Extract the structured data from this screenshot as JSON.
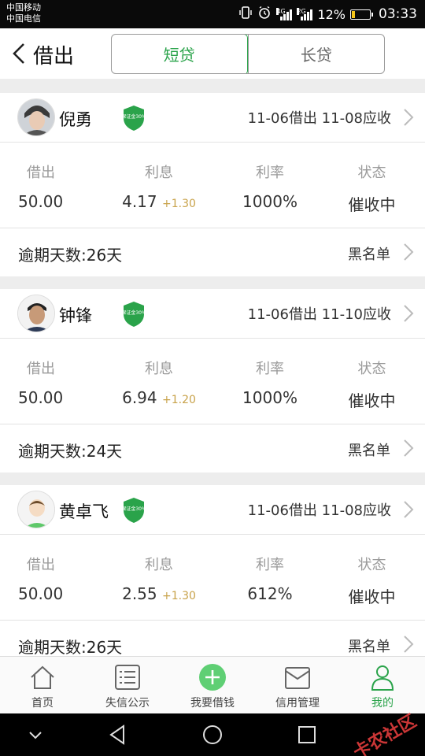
{
  "status_bar": {
    "carrier1": "中国移动",
    "carrier2": "中国电信",
    "battery": "12%",
    "time": "03:33",
    "icons": [
      "vibrate-icon",
      "alarm-icon",
      "signal-4g-icon",
      "signal-2g-icon",
      "battery-icon"
    ]
  },
  "header": {
    "title": "借出",
    "tabs": [
      {
        "label": "短贷",
        "active": true
      },
      {
        "label": "长贷",
        "active": false
      }
    ]
  },
  "stat_labels": {
    "lent": "借出",
    "interest": "利息",
    "rate": "利率",
    "status": "状态"
  },
  "records": [
    {
      "name": "倪勇",
      "badge": "保证金30%",
      "dates": "11-06借出 11-08应收",
      "lent": "50.00",
      "interest": "4.17",
      "interest_extra": "+1.30",
      "rate": "1000%",
      "status": "催收中",
      "overdue": "逾期天数:26天",
      "blacklist": "黑名单"
    },
    {
      "name": "钟锋",
      "badge": "保证金30%",
      "dates": "11-06借出 11-10应收",
      "lent": "50.00",
      "interest": "6.94",
      "interest_extra": "+1.20",
      "rate": "1000%",
      "status": "催收中",
      "overdue": "逾期天数:24天",
      "blacklist": "黑名单"
    },
    {
      "name": "黄卓飞",
      "badge": "保证金30%",
      "dates": "11-06借出 11-08应收",
      "lent": "50.00",
      "interest": "2.55",
      "interest_extra": "+1.30",
      "rate": "612%",
      "status": "催收中",
      "overdue": "逾期天数:26天",
      "blacklist": "黑名单"
    }
  ],
  "bottom_nav": [
    {
      "label": "首页",
      "icon": "home-icon",
      "active": false
    },
    {
      "label": "失信公示",
      "icon": "list-icon",
      "active": false
    },
    {
      "label": "我要借钱",
      "icon": "plus-circle-icon",
      "active": false
    },
    {
      "label": "信用管理",
      "icon": "envelope-icon",
      "active": false
    },
    {
      "label": "我的",
      "icon": "user-icon",
      "active": true
    }
  ],
  "colors": {
    "accent": "#2aa34a",
    "interest_extra": "#c8a24a",
    "watermark": "#e03c3c"
  },
  "watermark": "卡农社区"
}
